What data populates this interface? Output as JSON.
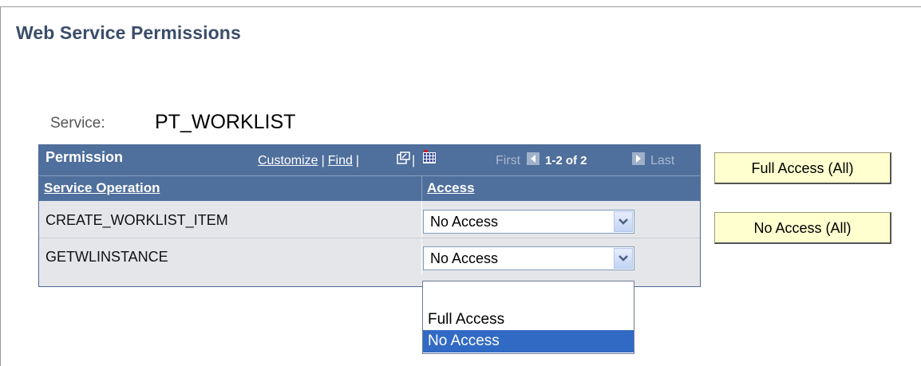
{
  "page": {
    "title": "Web Service Permissions"
  },
  "service": {
    "label": "Service:",
    "value": "PT_WORKLIST"
  },
  "grid": {
    "title": "Permission",
    "links": {
      "customize": "Customize",
      "find": "Find",
      "separator": "|"
    },
    "nav": {
      "first": "First",
      "count": "1-2 of 2",
      "last": "Last"
    },
    "columns": {
      "operation": "Service Operation",
      "access": "Access"
    },
    "rows": [
      {
        "operation": "CREATE_WORKLIST_ITEM",
        "access": "No Access"
      },
      {
        "operation": "GETWLINSTANCE",
        "access": "No Access"
      }
    ]
  },
  "dropdown": {
    "options": [
      "",
      "Full Access",
      "No Access"
    ],
    "selected": "No Access"
  },
  "buttons": {
    "full_access_all": "Full Access (All)",
    "no_access_all": "No Access (All)"
  },
  "colors": {
    "header": "#4f6f9c",
    "row_bg": "#e4e6ea",
    "button_bg": "#ffffd0",
    "selected_option": "#316ac5",
    "title": "#3b4d6b"
  },
  "icons": [
    "new-window-icon",
    "download-grid-icon",
    "first-arrow-icon",
    "last-arrow-icon",
    "chevron-down-icon"
  ]
}
